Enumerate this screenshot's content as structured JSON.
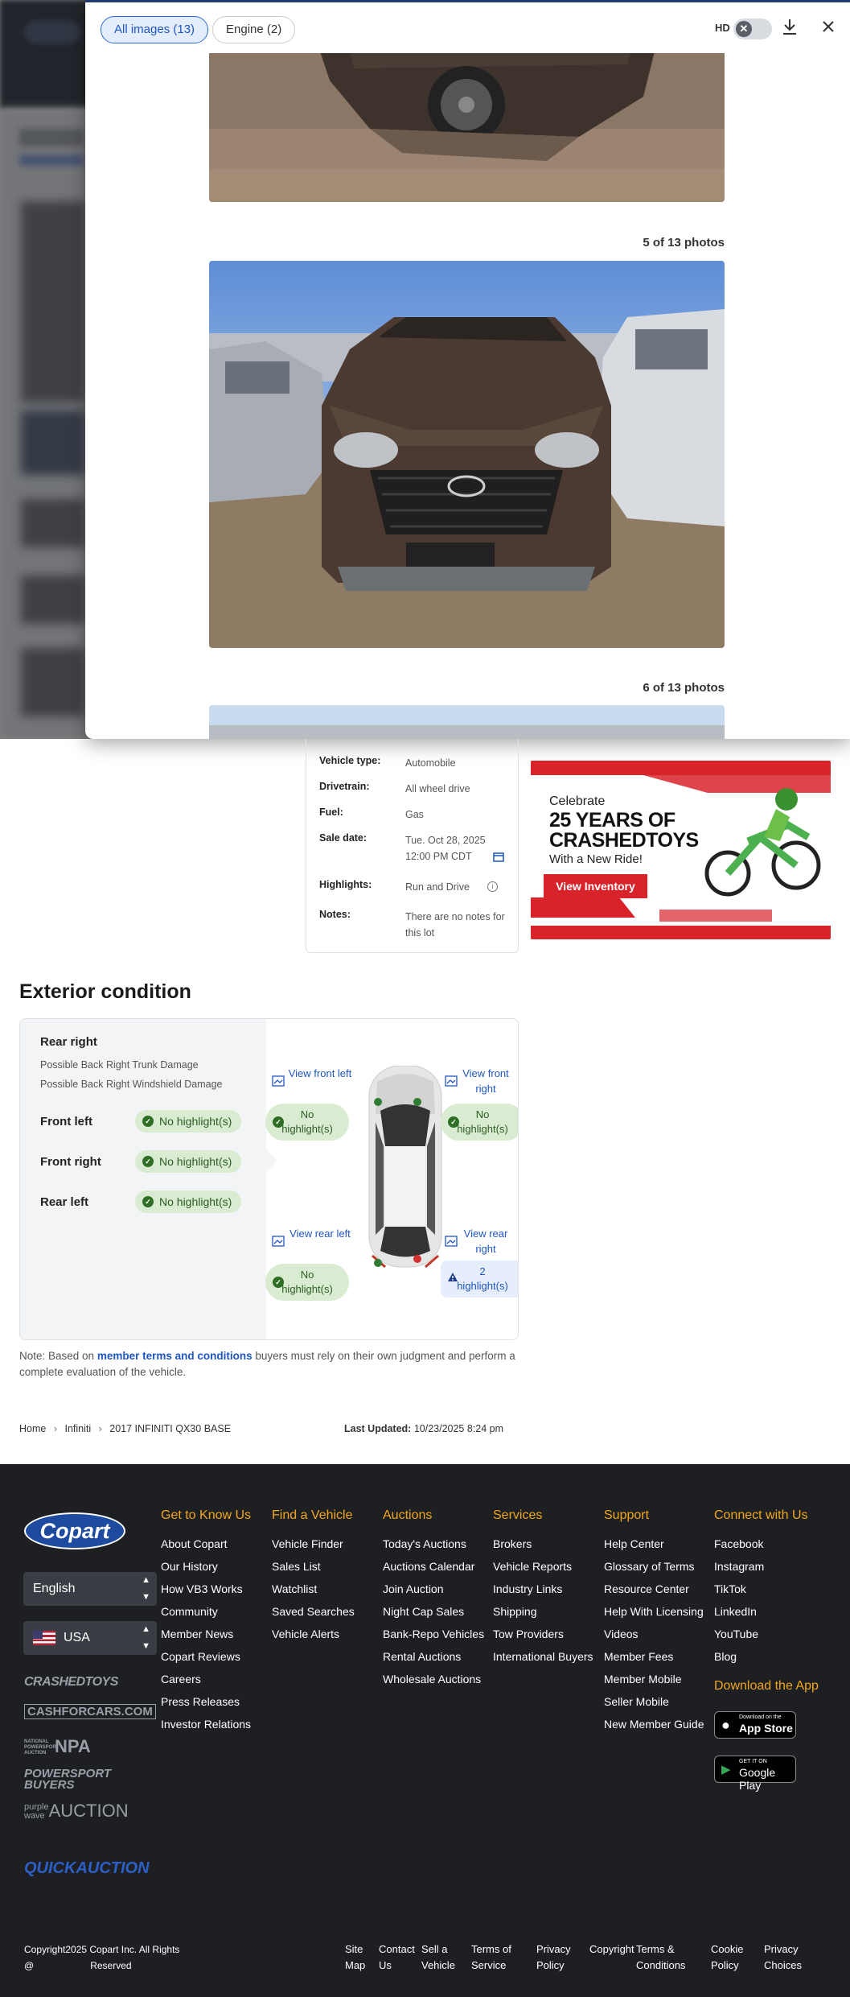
{
  "modal": {
    "chip_all": "All images (13)",
    "chip_engine": "Engine (2)",
    "hd_label": "HD",
    "count_5": "5 of 13 photos",
    "count_6": "6 of 13 photos"
  },
  "details": {
    "rows": [
      {
        "k": "Vehicle type:",
        "v": "Automobile"
      },
      {
        "k": "Drivetrain:",
        "v": "All wheel drive"
      },
      {
        "k": "Fuel:",
        "v": "Gas"
      },
      {
        "k": "Sale date:",
        "v": "Tue. Oct 28, 2025"
      },
      {
        "k": "",
        "v": "12:00 PM CDT"
      },
      {
        "k": "Highlights:",
        "v": "Run and Drive"
      },
      {
        "k": "Notes:",
        "v": "There are no notes for this lot"
      }
    ]
  },
  "ad": {
    "line1": "Celebrate",
    "line2": "25 YEARS OF",
    "line3": "CRASHEDTOYS",
    "line4": "With a New Ride!",
    "cta": "View Inventory"
  },
  "exterior": {
    "title": "Exterior condition",
    "rear_right_title": "Rear right",
    "damage1": "Possible Back Right Trunk Damage",
    "damage2": "Possible Back Right Windshield Damage",
    "front_left": "Front left",
    "front_right": "Front right",
    "rear_left": "Rear left",
    "no_highlight": "No highlight(s)",
    "view_front_left": "View front left",
    "view_front_right": "View front right",
    "view_rear_left": "View rear left",
    "view_rear_right": "View rear right",
    "bubble_no_1": "No",
    "bubble_no_2": "highlight(s)",
    "bubble_warn_1": "2",
    "bubble_warn_2": "highlight(s)"
  },
  "note": {
    "prefix": "Note: Based on ",
    "link": "member terms and conditions",
    "suffix": " buyers must rely on their own judgment and perform a complete evaluation of the vehicle."
  },
  "breadcrumb": {
    "home": "Home",
    "make": "Infiniti",
    "vehicle": "2017 INFINITI QX30 BASE"
  },
  "updated": {
    "label": "Last Updated:",
    "value": "10/23/2025 8:24 pm"
  },
  "footer": {
    "logo": "Copart",
    "language": "English",
    "country": "USA",
    "brands": [
      "CRASHEDTOYS",
      "CASHFORCARS.COM",
      "NPA",
      "POWERSPORT BUYERS",
      "AUCTION",
      "QUICKAUCTION"
    ],
    "brand_prefixes": {
      "npa": "NATIONAL POWERSPORT AUCTION",
      "purplewave_1": "purple",
      "purplewave_2": "wave"
    },
    "cols": [
      {
        "title": "Get to Know Us",
        "items": [
          "About Copart",
          "Our History",
          "How VB3 Works",
          "Community",
          "Member News",
          "Copart Reviews",
          "Careers",
          "Press Releases",
          "Investor Relations"
        ]
      },
      {
        "title": "Find a Vehicle",
        "items": [
          "Vehicle Finder",
          "Sales List",
          "Watchlist",
          "Saved Searches",
          "Vehicle Alerts"
        ]
      },
      {
        "title": "Auctions",
        "items": [
          "Today's Auctions",
          "Auctions Calendar",
          "Join Auction",
          "Night Cap Sales",
          "Bank-Repo Vehicles",
          "Rental Auctions",
          "Wholesale Auctions"
        ]
      },
      {
        "title": "Services",
        "items": [
          "Brokers",
          "Vehicle Reports",
          "Industry Links",
          "Shipping",
          "Tow Providers",
          "International Buyers"
        ]
      },
      {
        "title": "Support",
        "items": [
          "Help Center",
          "Glossary of Terms",
          "Resource Center",
          "Help With Licensing",
          "Videos",
          "Member Fees",
          "Member Mobile",
          "Seller Mobile",
          "New Member Guide"
        ]
      },
      {
        "title": "Connect with Us",
        "items": [
          "Facebook",
          "Instagram",
          "TikTok",
          "LinkedIn",
          "YouTube",
          "Blog"
        ]
      }
    ],
    "download_title": "Download the App",
    "app_store_small": "Download on the",
    "app_store": "App Store",
    "google_small": "GET IT ON",
    "google": "Google Play",
    "copyright_1": "Copyright2025 Copart Inc. All Rights",
    "copyright_2a": "@",
    "copyright_2b": "Reserved",
    "bottom_links": [
      {
        "l1": "Site",
        "l2": "Map"
      },
      {
        "l1": "Contact",
        "l2": "Us"
      },
      {
        "l1": "Sell a",
        "l2": "Vehicle"
      },
      {
        "l1": "Terms of",
        "l2": "Service"
      },
      {
        "l1": "Privacy",
        "l2": "Policy"
      },
      {
        "l1": "Copyright",
        "l2": ""
      },
      {
        "l1": "Terms &",
        "l2": "Conditions"
      },
      {
        "l1": "Cookie",
        "l2": "Policy"
      },
      {
        "l1": "Privacy",
        "l2": "Choices"
      }
    ]
  }
}
